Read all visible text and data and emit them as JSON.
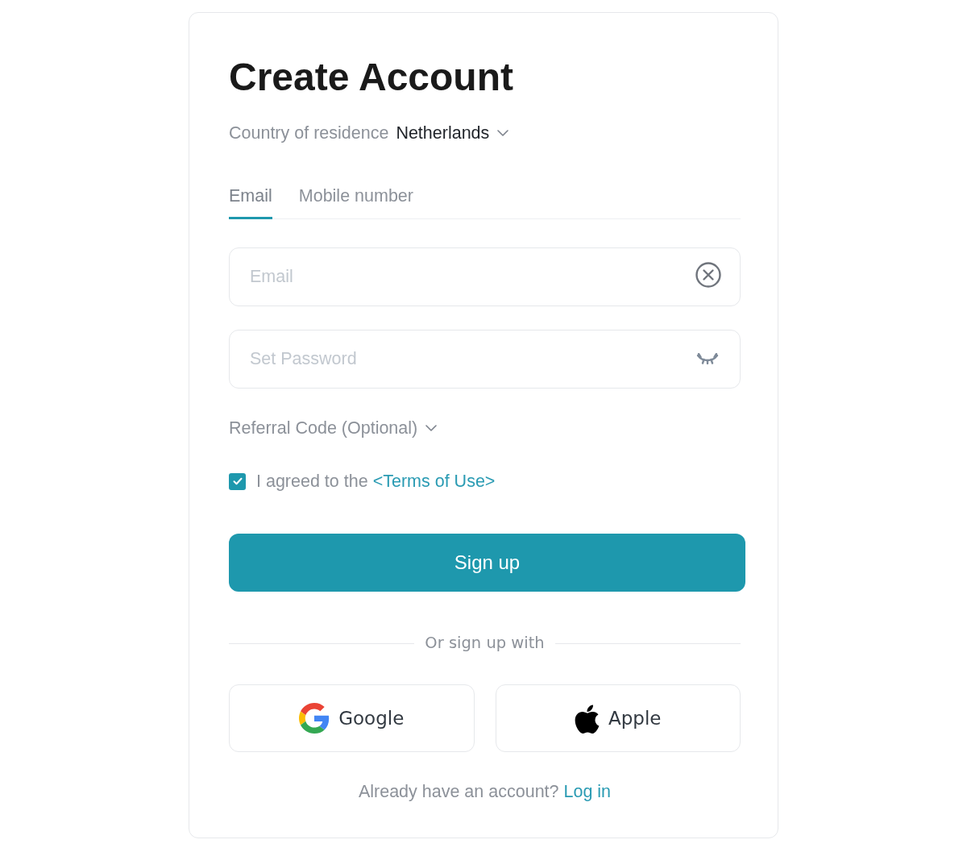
{
  "title": "Create Account",
  "country": {
    "label": "Country of residence",
    "value": "Netherlands"
  },
  "tabs": [
    {
      "label": "Email",
      "selected": true
    },
    {
      "label": "Mobile number",
      "selected": false
    }
  ],
  "fields": [
    {
      "kind": "email",
      "placeholder": "Email"
    },
    {
      "kind": "password",
      "placeholder": "Set Password"
    }
  ],
  "referral": {
    "label": "Referral Code (Optional)"
  },
  "terms": {
    "checked": true,
    "text": "I agreed to the",
    "link": "<Terms of Use>"
  },
  "sign_up_button": "Sign up",
  "divider_text": "Or sign up with",
  "social_buttons": [
    {
      "kind": "google",
      "label": "Google"
    },
    {
      "kind": "apple",
      "label": "Apple"
    }
  ],
  "login_prompt": {
    "text": "Already have an account?",
    "link": "Log in"
  }
}
